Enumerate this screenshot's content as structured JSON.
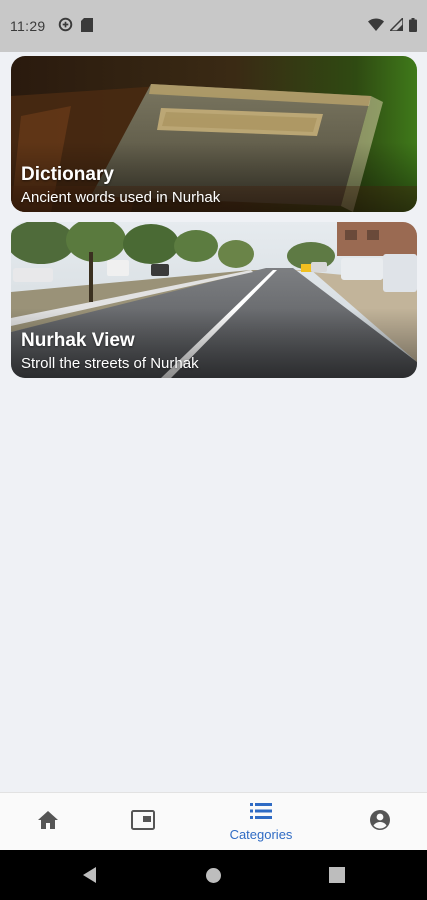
{
  "status_bar": {
    "time": "11:29",
    "left_icons": [
      "data-saver-icon",
      "sd-card-icon"
    ],
    "right_icons": [
      "wifi-icon",
      "cell-signal-icon",
      "battery-icon"
    ]
  },
  "cards": [
    {
      "title": "Dictionary",
      "subtitle": "Ancient words used in Nurhak",
      "image": "old-book-photo"
    },
    {
      "title": "Nurhak View",
      "subtitle": "Stroll the streets of Nurhak",
      "image": "street-road-photo"
    }
  ],
  "bottom_nav": {
    "items": [
      {
        "icon": "home-icon",
        "label": ""
      },
      {
        "icon": "picture-in-picture-icon",
        "label": ""
      },
      {
        "icon": "list-icon",
        "label": "Categories",
        "active": true
      },
      {
        "icon": "account-circle-icon",
        "label": ""
      }
    ],
    "active_color": "#2f6bc4",
    "inactive_color": "#555555"
  },
  "system_nav": [
    "back-button",
    "home-button",
    "recents-button"
  ]
}
